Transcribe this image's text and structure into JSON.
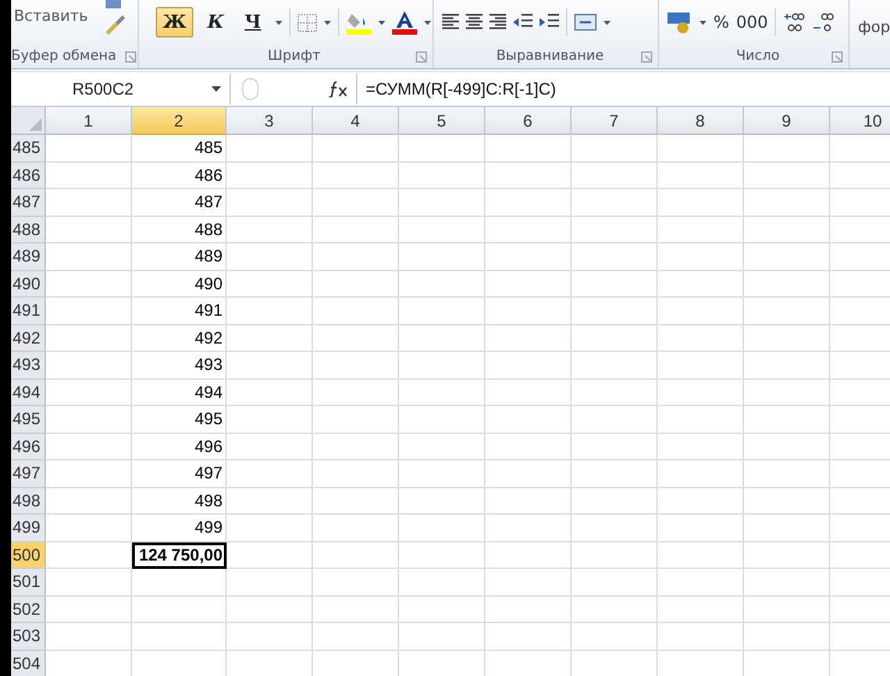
{
  "ribbon": {
    "paste_label": "Вставить",
    "font_buttons": [
      {
        "label": "Ж",
        "selected": true
      },
      {
        "label": "К",
        "selected": false
      },
      {
        "label": "Ч",
        "selected": false
      }
    ],
    "number_buttons": [
      "%",
      "000"
    ],
    "groups": [
      {
        "label": "Буфер обмена"
      },
      {
        "label": "Шрифт"
      },
      {
        "label": "Выравнивание"
      },
      {
        "label": "Число"
      }
    ],
    "cut_group_label": "фор"
  },
  "formula_bar": {
    "name_box": "R500C2",
    "formula": "=СУММ(R[-499]C:R[-1]C)"
  },
  "sheet": {
    "columns": [
      {
        "label": "1",
        "selected": false
      },
      {
        "label": "2",
        "selected": true
      },
      {
        "label": "3",
        "selected": false
      },
      {
        "label": "4",
        "selected": false
      },
      {
        "label": "5",
        "selected": false
      },
      {
        "label": "6",
        "selected": false
      },
      {
        "label": "7",
        "selected": false
      },
      {
        "label": "8",
        "selected": false
      },
      {
        "label": "9",
        "selected": false
      },
      {
        "label": "10",
        "selected": false
      }
    ],
    "rows": [
      {
        "header": "485",
        "selected": false,
        "value": "485"
      },
      {
        "header": "486",
        "selected": false,
        "value": "486"
      },
      {
        "header": "487",
        "selected": false,
        "value": "487"
      },
      {
        "header": "488",
        "selected": false,
        "value": "488"
      },
      {
        "header": "489",
        "selected": false,
        "value": "489"
      },
      {
        "header": "490",
        "selected": false,
        "value": "490"
      },
      {
        "header": "491",
        "selected": false,
        "value": "491"
      },
      {
        "header": "492",
        "selected": false,
        "value": "492"
      },
      {
        "header": "493",
        "selected": false,
        "value": "493"
      },
      {
        "header": "494",
        "selected": false,
        "value": "494"
      },
      {
        "header": "495",
        "selected": false,
        "value": "495"
      },
      {
        "header": "496",
        "selected": false,
        "value": "496"
      },
      {
        "header": "497",
        "selected": false,
        "value": "497"
      },
      {
        "header": "498",
        "selected": false,
        "value": "498"
      },
      {
        "header": "499",
        "selected": false,
        "value": "499"
      },
      {
        "header": "500",
        "selected": true,
        "value": "124 750,00"
      },
      {
        "header": "501",
        "selected": false
      },
      {
        "header": "502",
        "selected": false
      },
      {
        "header": "503",
        "selected": false
      },
      {
        "header": "504",
        "selected": false
      }
    ]
  }
}
